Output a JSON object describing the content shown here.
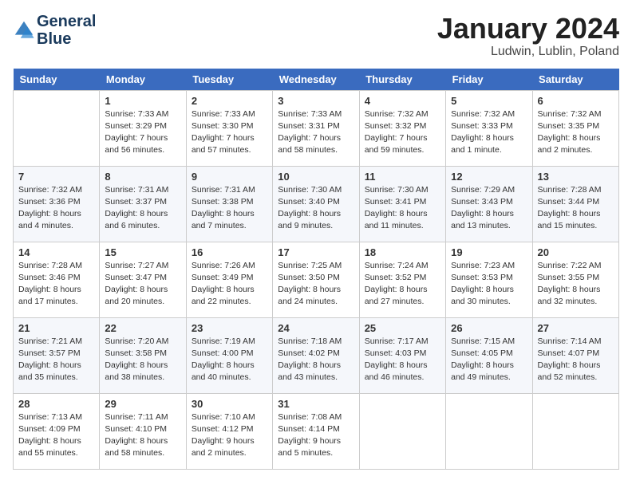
{
  "logo": {
    "line1": "General",
    "line2": "Blue"
  },
  "title": "January 2024",
  "location": "Ludwin, Lublin, Poland",
  "days_of_week": [
    "Sunday",
    "Monday",
    "Tuesday",
    "Wednesday",
    "Thursday",
    "Friday",
    "Saturday"
  ],
  "weeks": [
    [
      {
        "num": "",
        "info": ""
      },
      {
        "num": "1",
        "info": "Sunrise: 7:33 AM\nSunset: 3:29 PM\nDaylight: 7 hours\nand 56 minutes."
      },
      {
        "num": "2",
        "info": "Sunrise: 7:33 AM\nSunset: 3:30 PM\nDaylight: 7 hours\nand 57 minutes."
      },
      {
        "num": "3",
        "info": "Sunrise: 7:33 AM\nSunset: 3:31 PM\nDaylight: 7 hours\nand 58 minutes."
      },
      {
        "num": "4",
        "info": "Sunrise: 7:32 AM\nSunset: 3:32 PM\nDaylight: 7 hours\nand 59 minutes."
      },
      {
        "num": "5",
        "info": "Sunrise: 7:32 AM\nSunset: 3:33 PM\nDaylight: 8 hours\nand 1 minute."
      },
      {
        "num": "6",
        "info": "Sunrise: 7:32 AM\nSunset: 3:35 PM\nDaylight: 8 hours\nand 2 minutes."
      }
    ],
    [
      {
        "num": "7",
        "info": "Sunrise: 7:32 AM\nSunset: 3:36 PM\nDaylight: 8 hours\nand 4 minutes."
      },
      {
        "num": "8",
        "info": "Sunrise: 7:31 AM\nSunset: 3:37 PM\nDaylight: 8 hours\nand 6 minutes."
      },
      {
        "num": "9",
        "info": "Sunrise: 7:31 AM\nSunset: 3:38 PM\nDaylight: 8 hours\nand 7 minutes."
      },
      {
        "num": "10",
        "info": "Sunrise: 7:30 AM\nSunset: 3:40 PM\nDaylight: 8 hours\nand 9 minutes."
      },
      {
        "num": "11",
        "info": "Sunrise: 7:30 AM\nSunset: 3:41 PM\nDaylight: 8 hours\nand 11 minutes."
      },
      {
        "num": "12",
        "info": "Sunrise: 7:29 AM\nSunset: 3:43 PM\nDaylight: 8 hours\nand 13 minutes."
      },
      {
        "num": "13",
        "info": "Sunrise: 7:28 AM\nSunset: 3:44 PM\nDaylight: 8 hours\nand 15 minutes."
      }
    ],
    [
      {
        "num": "14",
        "info": "Sunrise: 7:28 AM\nSunset: 3:46 PM\nDaylight: 8 hours\nand 17 minutes."
      },
      {
        "num": "15",
        "info": "Sunrise: 7:27 AM\nSunset: 3:47 PM\nDaylight: 8 hours\nand 20 minutes."
      },
      {
        "num": "16",
        "info": "Sunrise: 7:26 AM\nSunset: 3:49 PM\nDaylight: 8 hours\nand 22 minutes."
      },
      {
        "num": "17",
        "info": "Sunrise: 7:25 AM\nSunset: 3:50 PM\nDaylight: 8 hours\nand 24 minutes."
      },
      {
        "num": "18",
        "info": "Sunrise: 7:24 AM\nSunset: 3:52 PM\nDaylight: 8 hours\nand 27 minutes."
      },
      {
        "num": "19",
        "info": "Sunrise: 7:23 AM\nSunset: 3:53 PM\nDaylight: 8 hours\nand 30 minutes."
      },
      {
        "num": "20",
        "info": "Sunrise: 7:22 AM\nSunset: 3:55 PM\nDaylight: 8 hours\nand 32 minutes."
      }
    ],
    [
      {
        "num": "21",
        "info": "Sunrise: 7:21 AM\nSunset: 3:57 PM\nDaylight: 8 hours\nand 35 minutes."
      },
      {
        "num": "22",
        "info": "Sunrise: 7:20 AM\nSunset: 3:58 PM\nDaylight: 8 hours\nand 38 minutes."
      },
      {
        "num": "23",
        "info": "Sunrise: 7:19 AM\nSunset: 4:00 PM\nDaylight: 8 hours\nand 40 minutes."
      },
      {
        "num": "24",
        "info": "Sunrise: 7:18 AM\nSunset: 4:02 PM\nDaylight: 8 hours\nand 43 minutes."
      },
      {
        "num": "25",
        "info": "Sunrise: 7:17 AM\nSunset: 4:03 PM\nDaylight: 8 hours\nand 46 minutes."
      },
      {
        "num": "26",
        "info": "Sunrise: 7:15 AM\nSunset: 4:05 PM\nDaylight: 8 hours\nand 49 minutes."
      },
      {
        "num": "27",
        "info": "Sunrise: 7:14 AM\nSunset: 4:07 PM\nDaylight: 8 hours\nand 52 minutes."
      }
    ],
    [
      {
        "num": "28",
        "info": "Sunrise: 7:13 AM\nSunset: 4:09 PM\nDaylight: 8 hours\nand 55 minutes."
      },
      {
        "num": "29",
        "info": "Sunrise: 7:11 AM\nSunset: 4:10 PM\nDaylight: 8 hours\nand 58 minutes."
      },
      {
        "num": "30",
        "info": "Sunrise: 7:10 AM\nSunset: 4:12 PM\nDaylight: 9 hours\nand 2 minutes."
      },
      {
        "num": "31",
        "info": "Sunrise: 7:08 AM\nSunset: 4:14 PM\nDaylight: 9 hours\nand 5 minutes."
      },
      {
        "num": "",
        "info": ""
      },
      {
        "num": "",
        "info": ""
      },
      {
        "num": "",
        "info": ""
      }
    ]
  ]
}
